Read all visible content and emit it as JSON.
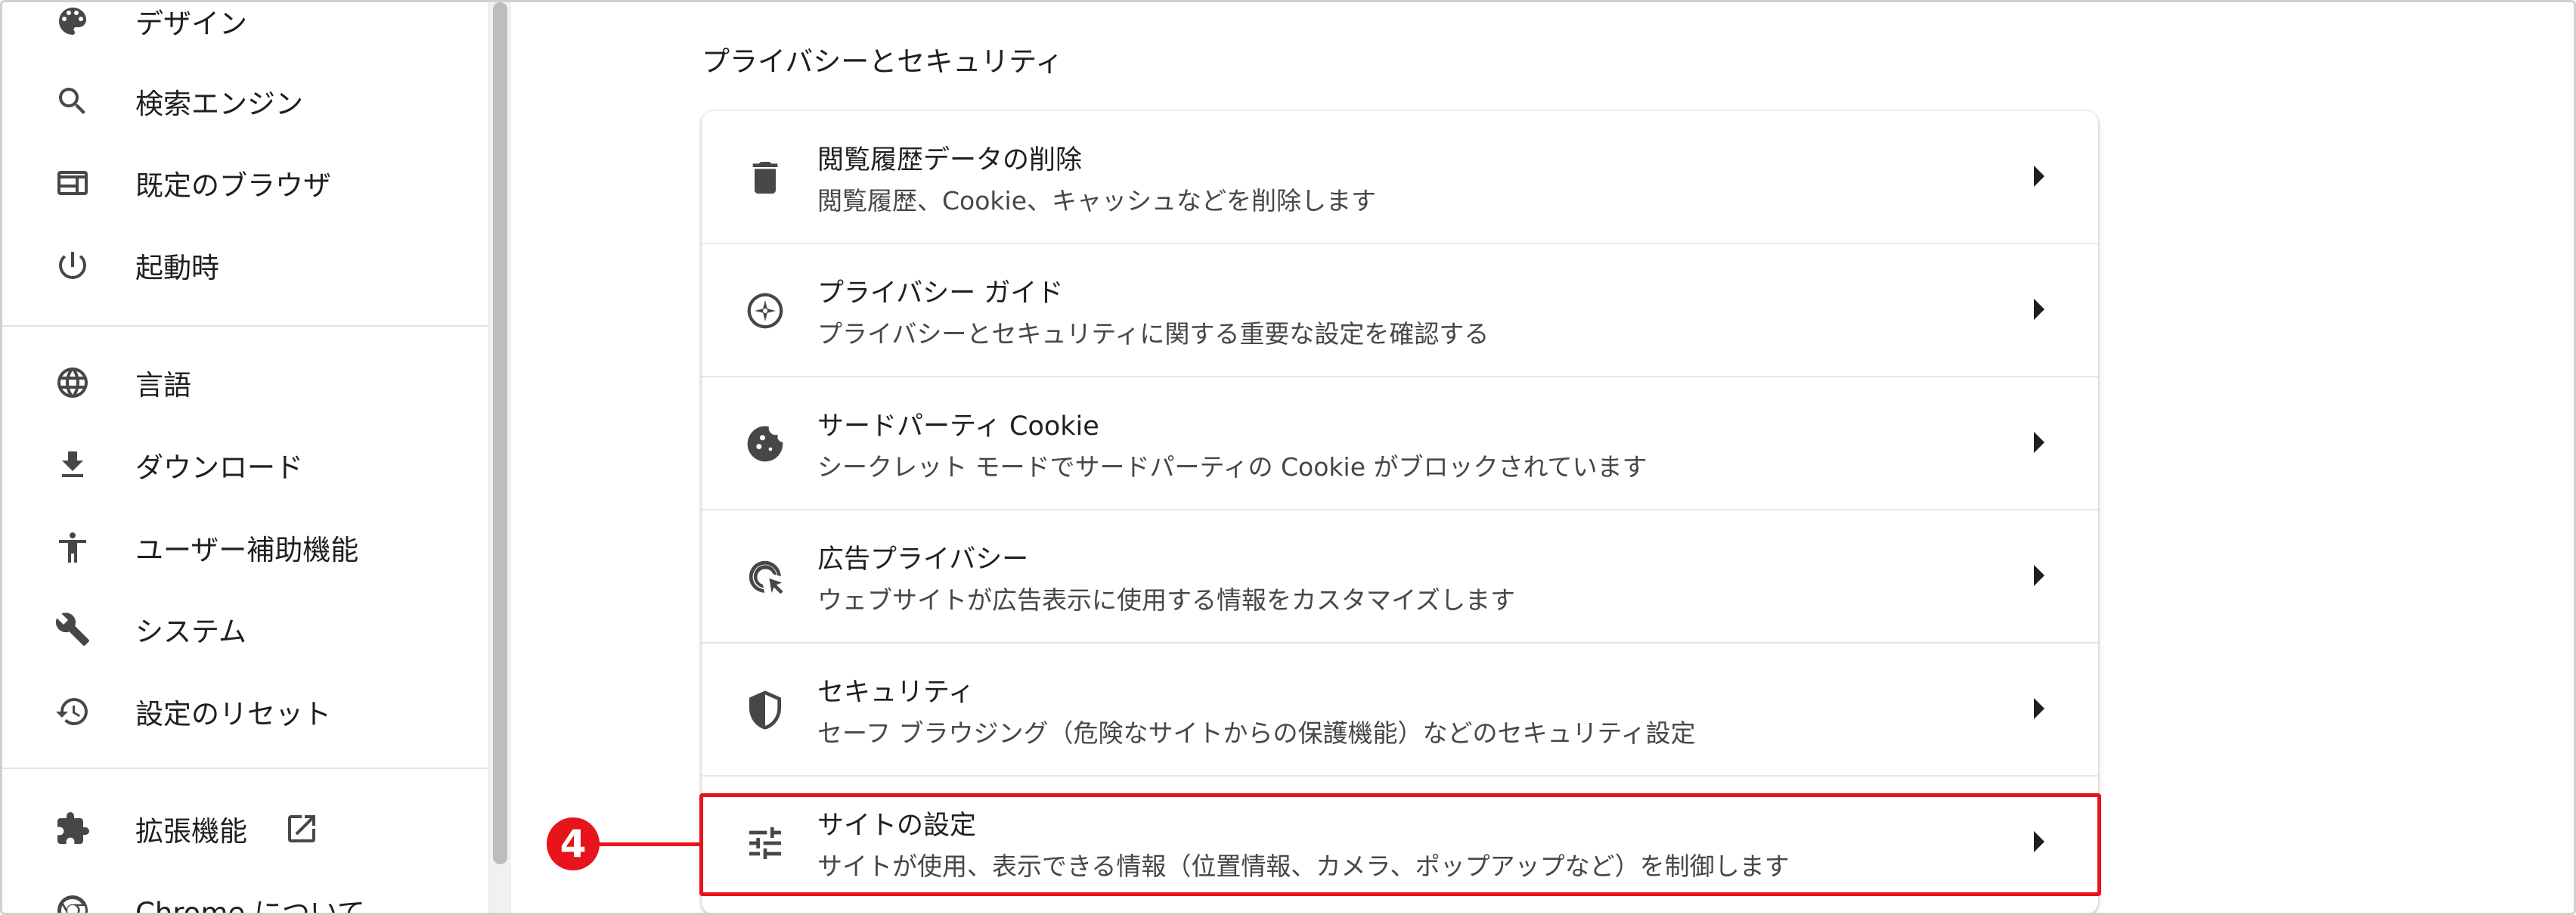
{
  "sidebar": {
    "items": [
      {
        "label": "デザイン",
        "icon": "palette-icon"
      },
      {
        "label": "検索エンジン",
        "icon": "search-icon"
      },
      {
        "label": "既定のブラウザ",
        "icon": "browser-window-icon"
      },
      {
        "label": "起動時",
        "icon": "power-icon"
      },
      {
        "label": "言語",
        "icon": "globe-icon"
      },
      {
        "label": "ダウンロード",
        "icon": "download-icon"
      },
      {
        "label": "ユーザー補助機能",
        "icon": "accessibility-icon"
      },
      {
        "label": "システム",
        "icon": "wrench-icon"
      },
      {
        "label": "設定のリセット",
        "icon": "history-reset-icon"
      },
      {
        "label": "拡張機能",
        "icon": "puzzle-icon"
      },
      {
        "label": "Chrome について",
        "icon": "chrome-icon"
      }
    ]
  },
  "main": {
    "section_title": "プライバシーとセキュリティ",
    "rows": [
      {
        "title": "閲覧履歴データの削除",
        "subtitle": "閲覧履歴、Cookie、キャッシュなどを削除します",
        "icon": "trash-icon"
      },
      {
        "title": "プライバシー ガイド",
        "subtitle": "プライバシーとセキュリティに関する重要な設定を確認する",
        "icon": "compass-icon"
      },
      {
        "title": "サードパーティ Cookie",
        "subtitle": "シークレット モードでサードパーティの Cookie がブロックされています",
        "icon": "cookie-icon"
      },
      {
        "title": "広告プライバシー",
        "subtitle": "ウェブサイトが広告表示に使用する情報をカスタマイズします",
        "icon": "ad-cursor-icon"
      },
      {
        "title": "セキュリティ",
        "subtitle": "セーフ ブラウジング（危険なサイトからの保護機能）などのセキュリティ設定",
        "icon": "shield-icon"
      },
      {
        "title": "サイトの設定",
        "subtitle": "サイトが使用、表示できる情報（位置情報、カメラ、ポップアップなど）を制御します",
        "icon": "tune-sliders-icon"
      }
    ]
  },
  "annotation": {
    "step_number": "4",
    "color": "#e8141b"
  }
}
